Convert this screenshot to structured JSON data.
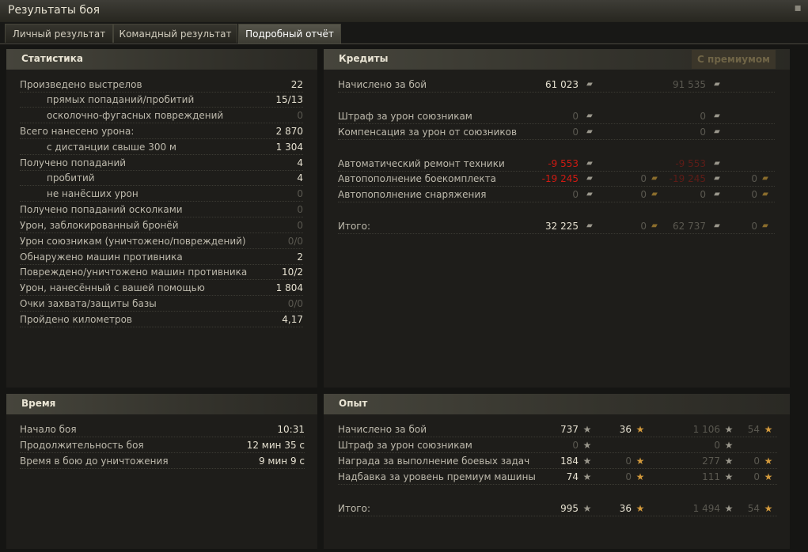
{
  "window": {
    "title": "Результаты боя",
    "close_icon": "close-icon"
  },
  "tabs": [
    {
      "label": "Личный результат"
    },
    {
      "label": "Командный результат"
    },
    {
      "label": "Подробный отчёт"
    }
  ],
  "stats": {
    "title": "Статистика",
    "rows": [
      {
        "label": "Произведено выстрелов",
        "value": "22",
        "indent": false,
        "dim": false
      },
      {
        "label": "прямых попаданий/пробитий",
        "value": "15/13",
        "indent": true,
        "dim": false
      },
      {
        "label": "осколочно-фугасных повреждений",
        "value": "0",
        "indent": true,
        "dim": true
      },
      {
        "label": "Всего нанесено урона:",
        "value": "2 870",
        "indent": false,
        "dim": false
      },
      {
        "label": "с дистанции свыше 300 м",
        "value": "1 304",
        "indent": true,
        "dim": false
      },
      {
        "label": "Получено попаданий",
        "value": "4",
        "indent": false,
        "dim": false
      },
      {
        "label": "пробитий",
        "value": "4",
        "indent": true,
        "dim": false
      },
      {
        "label": "не нанёсших урон",
        "value": "0",
        "indent": true,
        "dim": true
      },
      {
        "label": "Получено попаданий осколками",
        "value": "0",
        "indent": false,
        "dim": true
      },
      {
        "label": "Урон, заблокированный бронёй",
        "value": "0",
        "indent": false,
        "dim": true
      },
      {
        "label": "Урон союзникам (уничтожено/повреждений)",
        "value": "0/0",
        "indent": false,
        "dim": true
      },
      {
        "label": "Обнаружено машин противника",
        "value": "2",
        "indent": false,
        "dim": false
      },
      {
        "label": "Повреждено/уничтожено машин противника",
        "value": "10/2",
        "indent": false,
        "dim": false
      },
      {
        "label": "Урон, нанесённый с вашей помощью",
        "value": "1 804",
        "indent": false,
        "dim": false
      },
      {
        "label": "Очки захвата/защиты базы",
        "value": "0/0",
        "indent": false,
        "dim": true
      },
      {
        "label": "Пройдено километров",
        "value": "4,17",
        "indent": false,
        "dim": false
      }
    ]
  },
  "credits": {
    "title": "Кредиты",
    "premium_label": "С премиумом",
    "rows": [
      {
        "label": "Начислено за бой",
        "c1": "61 023",
        "c1s": "",
        "g1": "",
        "g1s": "",
        "c2": "91 535",
        "c2s": "dim",
        "g2": "",
        "g2s": ""
      },
      {
        "label": "Штраф за урон союзникам",
        "c1": "0",
        "c1s": "dim",
        "g1": "",
        "g1s": "",
        "c2": "0",
        "c2s": "dim",
        "g2": "",
        "g2s": ""
      },
      {
        "label": "Компенсация за урон от союзников",
        "c1": "0",
        "c1s": "dim",
        "g1": "",
        "g1s": "",
        "c2": "0",
        "c2s": "dim",
        "g2": "",
        "g2s": ""
      },
      {
        "label": "Автоматический ремонт техники",
        "c1": "-9 553",
        "c1s": "red",
        "g1": "",
        "g1s": "",
        "c2": "-9 553",
        "c2s": "dred",
        "g2": "",
        "g2s": ""
      },
      {
        "label": "Автопополнение боекомплекта",
        "c1": "-19 245",
        "c1s": "red",
        "g1": "0",
        "g1s": "dim",
        "c2": "-19 245",
        "c2s": "dred",
        "g2": "0",
        "g2s": "dim"
      },
      {
        "label": "Автопополнение снаряжения",
        "c1": "0",
        "c1s": "dim",
        "g1": "0",
        "g1s": "dim",
        "c2": "0",
        "c2s": "dim",
        "g2": "0",
        "g2s": "dim"
      },
      {
        "label": "Итого:",
        "c1": "32 225",
        "c1s": "",
        "g1": "0",
        "g1s": "dim",
        "c2": "62 737",
        "c2s": "dim",
        "g2": "0",
        "g2s": "dim"
      }
    ]
  },
  "time": {
    "title": "Время",
    "rows": [
      {
        "label": "Начало боя",
        "value": "10:31"
      },
      {
        "label": "Продолжительность боя",
        "value": "12 мин 35 с"
      },
      {
        "label": "Время в бою до уничтожения",
        "value": "9 мин 9 с"
      }
    ]
  },
  "xp": {
    "title": "Опыт",
    "rows": [
      {
        "label": "Начислено за бой",
        "a": "737",
        "as": "",
        "b": "36",
        "bs": "",
        "c": "1 106",
        "cs": "dim",
        "d": "54",
        "ds": "dim"
      },
      {
        "label": "Штраф за урон союзникам",
        "a": "0",
        "as": "dim",
        "b": "",
        "bs": "",
        "c": "0",
        "cs": "dim",
        "d": "",
        "ds": ""
      },
      {
        "label": "Награда за выполнение боевых задач",
        "a": "184",
        "as": "",
        "b": "0",
        "bs": "dim",
        "c": "277",
        "cs": "dim",
        "d": "0",
        "ds": "dim"
      },
      {
        "label": "Надбавка за уровень премиум машины",
        "a": "74",
        "as": "",
        "b": "0",
        "bs": "dim",
        "c": "111",
        "cs": "dim",
        "d": "0",
        "ds": "dim"
      },
      {
        "label": "Итого:",
        "a": "995",
        "as": "",
        "b": "36",
        "bs": "",
        "c": "1 494",
        "cs": "dim",
        "d": "54",
        "ds": "dim"
      }
    ]
  },
  "icons": {
    "credit": "credit-icon",
    "gold": "gold-icon",
    "xp": "xp-star-icon",
    "free_xp": "free-xp-star-icon"
  },
  "colors": {
    "penalty": "#d01a12",
    "dim": "#5a5850",
    "gold": "#d39a3c"
  }
}
